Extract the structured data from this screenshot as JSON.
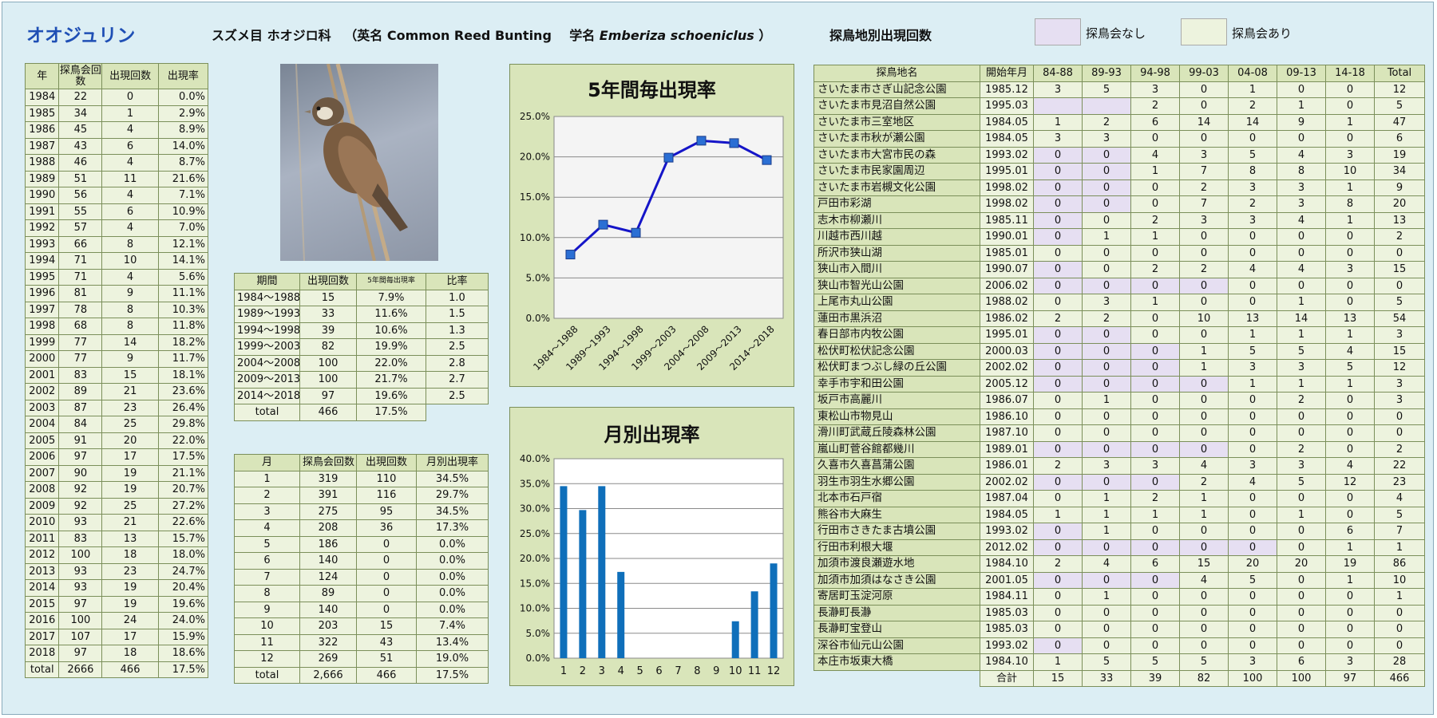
{
  "header": {
    "title": "オオジュリン",
    "family_label": "スズメ目 ホオジロ科",
    "english_prefix": "（英名 Common Reed Bunting",
    "sci_prefix": "学名",
    "sci_name": "Emberiza schoeniclus",
    "sci_suffix": "）",
    "site_table_title": "探鳥地別出現回数",
    "legend_none": "探鳥会なし",
    "legend_held": "探鳥会あり"
  },
  "colors": {
    "legend_none": "#e6dff2",
    "legend_held": "#edf3de",
    "line": "#1515c8",
    "bar": "#0f6fba"
  },
  "yearly": {
    "headers": [
      "年",
      "探鳥会回数",
      "出現回数",
      "出現率"
    ],
    "rows": [
      [
        "1984",
        "22",
        "0",
        "0.0%"
      ],
      [
        "1985",
        "34",
        "1",
        "2.9%"
      ],
      [
        "1986",
        "45",
        "4",
        "8.9%"
      ],
      [
        "1987",
        "43",
        "6",
        "14.0%"
      ],
      [
        "1988",
        "46",
        "4",
        "8.7%"
      ],
      [
        "1989",
        "51",
        "11",
        "21.6%"
      ],
      [
        "1990",
        "56",
        "4",
        "7.1%"
      ],
      [
        "1991",
        "55",
        "6",
        "10.9%"
      ],
      [
        "1992",
        "57",
        "4",
        "7.0%"
      ],
      [
        "1993",
        "66",
        "8",
        "12.1%"
      ],
      [
        "1994",
        "71",
        "10",
        "14.1%"
      ],
      [
        "1995",
        "71",
        "4",
        "5.6%"
      ],
      [
        "1996",
        "81",
        "9",
        "11.1%"
      ],
      [
        "1997",
        "78",
        "8",
        "10.3%"
      ],
      [
        "1998",
        "68",
        "8",
        "11.8%"
      ],
      [
        "1999",
        "77",
        "14",
        "18.2%"
      ],
      [
        "2000",
        "77",
        "9",
        "11.7%"
      ],
      [
        "2001",
        "83",
        "15",
        "18.1%"
      ],
      [
        "2002",
        "89",
        "21",
        "23.6%"
      ],
      [
        "2003",
        "87",
        "23",
        "26.4%"
      ],
      [
        "2004",
        "84",
        "25",
        "29.8%"
      ],
      [
        "2005",
        "91",
        "20",
        "22.0%"
      ],
      [
        "2006",
        "97",
        "17",
        "17.5%"
      ],
      [
        "2007",
        "90",
        "19",
        "21.1%"
      ],
      [
        "2008",
        "92",
        "19",
        "20.7%"
      ],
      [
        "2009",
        "92",
        "25",
        "27.2%"
      ],
      [
        "2010",
        "93",
        "21",
        "22.6%"
      ],
      [
        "2011",
        "83",
        "13",
        "15.7%"
      ],
      [
        "2012",
        "100",
        "18",
        "18.0%"
      ],
      [
        "2013",
        "93",
        "23",
        "24.7%"
      ],
      [
        "2014",
        "93",
        "19",
        "20.4%"
      ],
      [
        "2015",
        "97",
        "19",
        "19.6%"
      ],
      [
        "2016",
        "100",
        "24",
        "24.0%"
      ],
      [
        "2017",
        "107",
        "17",
        "15.9%"
      ],
      [
        "2018",
        "97",
        "18",
        "18.6%"
      ],
      [
        "total",
        "2666",
        "466",
        "17.5%"
      ]
    ]
  },
  "period": {
    "headers": [
      "期間",
      "出現回数",
      "5年間毎出現率",
      "比率"
    ],
    "rows": [
      [
        "1984～1988",
        "15",
        "7.9%",
        "1.0"
      ],
      [
        "1989～1993",
        "33",
        "11.6%",
        "1.5"
      ],
      [
        "1994～1998",
        "39",
        "10.6%",
        "1.3"
      ],
      [
        "1999～2003",
        "82",
        "19.9%",
        "2.5"
      ],
      [
        "2004～2008",
        "100",
        "22.0%",
        "2.8"
      ],
      [
        "2009～2013",
        "100",
        "21.7%",
        "2.7"
      ],
      [
        "2014～2018",
        "97",
        "19.6%",
        "2.5"
      ]
    ],
    "total": [
      "total",
      "466",
      "17.5%"
    ]
  },
  "monthly": {
    "headers": [
      "月",
      "探鳥会回数",
      "出現回数",
      "月別出現率"
    ],
    "rows": [
      [
        "1",
        "319",
        "110",
        "34.5%"
      ],
      [
        "2",
        "391",
        "116",
        "29.7%"
      ],
      [
        "3",
        "275",
        "95",
        "34.5%"
      ],
      [
        "4",
        "208",
        "36",
        "17.3%"
      ],
      [
        "5",
        "186",
        "0",
        "0.0%"
      ],
      [
        "6",
        "140",
        "0",
        "0.0%"
      ],
      [
        "7",
        "124",
        "0",
        "0.0%"
      ],
      [
        "8",
        "89",
        "0",
        "0.0%"
      ],
      [
        "9",
        "140",
        "0",
        "0.0%"
      ],
      [
        "10",
        "203",
        "15",
        "7.4%"
      ],
      [
        "11",
        "322",
        "43",
        "13.4%"
      ],
      [
        "12",
        "269",
        "51",
        "19.0%"
      ],
      [
        "total",
        "2,666",
        "466",
        "17.5%"
      ]
    ]
  },
  "sites": {
    "headers": [
      "探鳥地名",
      "開始年月",
      "84-88",
      "89-93",
      "94-98",
      "99-03",
      "04-08",
      "09-13",
      "14-18",
      "Total"
    ],
    "rows": [
      [
        "さいたま市さぎ山記念公園",
        "1985.12",
        "3",
        "5",
        "3",
        "0",
        "1",
        "0",
        "0",
        "12"
      ],
      [
        "さいたま市見沼自然公園",
        "1995.03",
        "",
        "",
        "2",
        "0",
        "2",
        "1",
        "0",
        "5"
      ],
      [
        "さいたま市三室地区",
        "1984.05",
        "1",
        "2",
        "6",
        "14",
        "14",
        "9",
        "1",
        "47"
      ],
      [
        "さいたま市秋が瀬公園",
        "1984.05",
        "3",
        "3",
        "0",
        "0",
        "0",
        "0",
        "0",
        "6"
      ],
      [
        "さいたま市大宮市民の森",
        "1993.02",
        "0",
        "0",
        "4",
        "3",
        "5",
        "4",
        "3",
        "19"
      ],
      [
        "さいたま市民家園周辺",
        "1995.01",
        "0",
        "0",
        "1",
        "7",
        "8",
        "8",
        "10",
        "34"
      ],
      [
        "さいたま市岩槻文化公園",
        "1998.02",
        "0",
        "0",
        "0",
        "2",
        "3",
        "3",
        "1",
        "9"
      ],
      [
        "戸田市彩湖",
        "1998.02",
        "0",
        "0",
        "0",
        "7",
        "2",
        "3",
        "8",
        "20"
      ],
      [
        "志木市柳瀬川",
        "1985.11",
        "0",
        "0",
        "2",
        "3",
        "3",
        "4",
        "1",
        "13"
      ],
      [
        "川越市西川越",
        "1990.01",
        "0",
        "1",
        "1",
        "0",
        "0",
        "0",
        "0",
        "2"
      ],
      [
        "所沢市狭山湖",
        "1985.01",
        "0",
        "0",
        "0",
        "0",
        "0",
        "0",
        "0",
        "0"
      ],
      [
        "狭山市入間川",
        "1990.07",
        "0",
        "0",
        "2",
        "2",
        "4",
        "4",
        "3",
        "15"
      ],
      [
        "狭山市智光山公園",
        "2006.02",
        "0",
        "0",
        "0",
        "0",
        "0",
        "0",
        "0",
        "0"
      ],
      [
        "上尾市丸山公園",
        "1988.02",
        "0",
        "3",
        "1",
        "0",
        "0",
        "1",
        "0",
        "5"
      ],
      [
        "蓮田市黒浜沼",
        "1986.02",
        "2",
        "2",
        "0",
        "10",
        "13",
        "14",
        "13",
        "54"
      ],
      [
        "春日部市内牧公園",
        "1995.01",
        "0",
        "0",
        "0",
        "0",
        "1",
        "1",
        "1",
        "3"
      ],
      [
        "松伏町松伏記念公園",
        "2000.03",
        "0",
        "0",
        "0",
        "1",
        "5",
        "5",
        "4",
        "15"
      ],
      [
        "松伏町まつぶし緑の丘公園",
        "2002.02",
        "0",
        "0",
        "0",
        "1",
        "3",
        "3",
        "5",
        "12"
      ],
      [
        "幸手市宇和田公園",
        "2005.12",
        "0",
        "0",
        "0",
        "0",
        "1",
        "1",
        "1",
        "3"
      ],
      [
        "坂戸市高麗川",
        "1986.07",
        "0",
        "1",
        "0",
        "0",
        "0",
        "2",
        "0",
        "3"
      ],
      [
        "東松山市物見山",
        "1986.10",
        "0",
        "0",
        "0",
        "0",
        "0",
        "0",
        "0",
        "0"
      ],
      [
        "滑川町武蔵丘陵森林公園",
        "1987.10",
        "0",
        "0",
        "0",
        "0",
        "0",
        "0",
        "0",
        "0"
      ],
      [
        "嵐山町菅谷館都幾川",
        "1989.01",
        "0",
        "0",
        "0",
        "0",
        "0",
        "2",
        "0",
        "2"
      ],
      [
        "久喜市久喜菖蒲公園",
        "1986.01",
        "2",
        "3",
        "3",
        "4",
        "3",
        "3",
        "4",
        "22"
      ],
      [
        "羽生市羽生水郷公園",
        "2002.02",
        "0",
        "0",
        "0",
        "2",
        "4",
        "5",
        "12",
        "23"
      ],
      [
        "北本市石戸宿",
        "1987.04",
        "0",
        "1",
        "2",
        "1",
        "0",
        "0",
        "0",
        "4"
      ],
      [
        "熊谷市大麻生",
        "1984.05",
        "1",
        "1",
        "1",
        "1",
        "0",
        "1",
        "0",
        "5"
      ],
      [
        "行田市さきたま古墳公園",
        "1993.02",
        "0",
        "1",
        "0",
        "0",
        "0",
        "0",
        "6",
        "7"
      ],
      [
        "行田市利根大堰",
        "2012.02",
        "0",
        "0",
        "0",
        "0",
        "0",
        "0",
        "1",
        "1"
      ],
      [
        "加須市渡良瀬遊水地",
        "1984.10",
        "2",
        "4",
        "6",
        "15",
        "20",
        "20",
        "19",
        "86"
      ],
      [
        "加須市加須はなさき公園",
        "2001.05",
        "0",
        "0",
        "0",
        "4",
        "5",
        "0",
        "1",
        "10"
      ],
      [
        "寄居町玉淀河原",
        "1984.11",
        "0",
        "1",
        "0",
        "0",
        "0",
        "0",
        "0",
        "1"
      ],
      [
        "長瀞町長瀞",
        "1985.03",
        "0",
        "0",
        "0",
        "0",
        "0",
        "0",
        "0",
        "0"
      ],
      [
        "長瀞町宝登山",
        "1985.03",
        "0",
        "0",
        "0",
        "0",
        "0",
        "0",
        "0",
        "0"
      ],
      [
        "深谷市仙元山公園",
        "1993.02",
        "0",
        "0",
        "0",
        "0",
        "0",
        "0",
        "0",
        "0"
      ],
      [
        "本庄市坂東大橋",
        "1984.10",
        "1",
        "5",
        "5",
        "5",
        "3",
        "6",
        "3",
        "28"
      ]
    ],
    "none_cells": [
      [
        1,
        2
      ],
      [
        1,
        3
      ],
      [
        4,
        2
      ],
      [
        4,
        3
      ],
      [
        5,
        2
      ],
      [
        5,
        3
      ],
      [
        6,
        2
      ],
      [
        6,
        3
      ],
      [
        7,
        2
      ],
      [
        7,
        3
      ],
      [
        8,
        2
      ],
      [
        9,
        2
      ],
      [
        11,
        2
      ],
      [
        12,
        2
      ],
      [
        12,
        3
      ],
      [
        12,
        4
      ],
      [
        12,
        5
      ],
      [
        15,
        2
      ],
      [
        15,
        3
      ],
      [
        16,
        2
      ],
      [
        16,
        3
      ],
      [
        16,
        4
      ],
      [
        17,
        2
      ],
      [
        17,
        3
      ],
      [
        17,
        4
      ],
      [
        18,
        2
      ],
      [
        18,
        3
      ],
      [
        18,
        4
      ],
      [
        18,
        5
      ],
      [
        22,
        2
      ],
      [
        22,
        3
      ],
      [
        22,
        4
      ],
      [
        22,
        5
      ],
      [
        24,
        2
      ],
      [
        24,
        3
      ],
      [
        24,
        4
      ],
      [
        27,
        2
      ],
      [
        28,
        2
      ],
      [
        28,
        3
      ],
      [
        28,
        4
      ],
      [
        28,
        5
      ],
      [
        28,
        6
      ],
      [
        30,
        2
      ],
      [
        30,
        3
      ],
      [
        30,
        4
      ],
      [
        34,
        2
      ]
    ],
    "total_label": "合計",
    "totals": [
      "15",
      "33",
      "39",
      "82",
      "100",
      "100",
      "97",
      "466"
    ]
  },
  "chart_data": [
    {
      "type": "line",
      "title": "5年間毎出現率",
      "categories": [
        "1984～1988",
        "1989～1993",
        "1994～1998",
        "1999～2003",
        "2004～2008",
        "2009～2013",
        "2014～2018"
      ],
      "values": [
        7.9,
        11.6,
        10.6,
        19.9,
        22.0,
        21.7,
        19.6
      ],
      "ylim": [
        0,
        25
      ],
      "yticks": [
        "0.0%",
        "5.0%",
        "10.0%",
        "15.0%",
        "20.0%",
        "25.0%"
      ],
      "grid": true
    },
    {
      "type": "bar",
      "title": "月別出現率",
      "categories": [
        "1",
        "2",
        "3",
        "4",
        "5",
        "6",
        "7",
        "8",
        "9",
        "10",
        "11",
        "12"
      ],
      "values": [
        34.5,
        29.7,
        34.5,
        17.3,
        0,
        0,
        0,
        0,
        0,
        7.4,
        13.4,
        19.0
      ],
      "ylim": [
        0,
        40
      ],
      "yticks": [
        "0.0%",
        "5.0%",
        "10.0%",
        "15.0%",
        "20.0%",
        "25.0%",
        "30.0%",
        "35.0%",
        "40.0%"
      ],
      "grid": true
    }
  ]
}
